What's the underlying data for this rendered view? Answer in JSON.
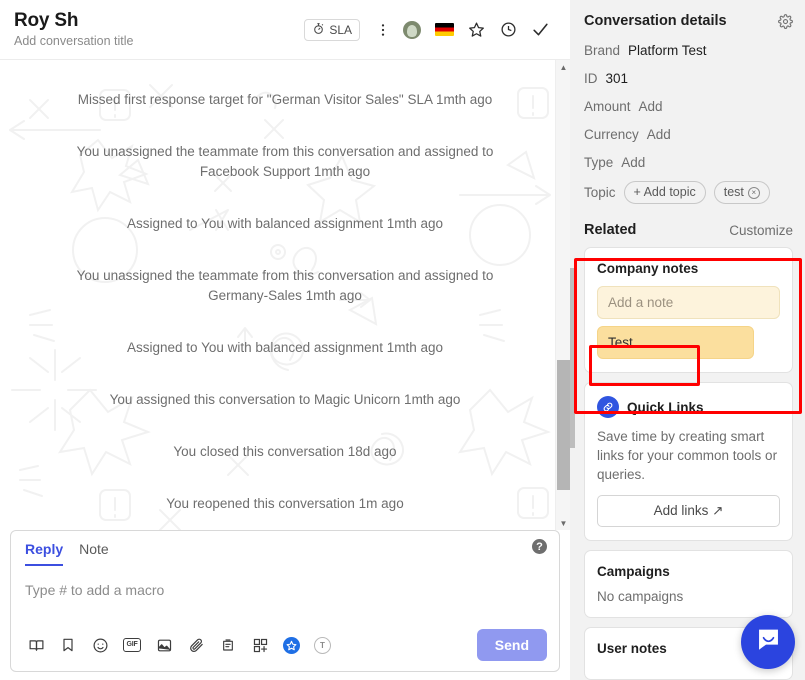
{
  "header": {
    "title": "Roy Sh",
    "subtitle": "Add conversation title",
    "sla_label": "SLA",
    "icons": {
      "sla": "stopwatch-icon",
      "more": "more-vertical-icon",
      "assignee": "assignee-avatar",
      "language": "german-flag-icon",
      "star": "star-icon",
      "snooze": "clock-icon",
      "close": "checkmark-icon"
    }
  },
  "conversation": {
    "events": [
      "Missed first response target for \"German Visitor Sales\" SLA 1mth ago",
      "You unassigned the teammate from this conversation and assigned to Facebook Support 1mth ago",
      "Assigned to You with balanced assignment 1mth ago",
      "You unassigned the teammate from this conversation and assigned to Germany-Sales 1mth ago",
      "Assigned to You with balanced assignment 1mth ago",
      "You assigned this conversation to Magic Unicorn 1mth ago",
      "You closed this conversation 18d ago",
      "You reopened this conversation 1m ago"
    ]
  },
  "composer": {
    "tabs": [
      {
        "label": "Reply",
        "active": true
      },
      {
        "label": "Note",
        "active": false
      }
    ],
    "placeholder": "Type # to add a macro",
    "help_label": "?",
    "send_label": "Send",
    "toolbar_icons": [
      "book-icon",
      "bookmark-icon",
      "emoji-icon",
      "gif-icon",
      "image-icon",
      "paperclip-icon",
      "article-icon",
      "apps-add-icon",
      "star-badge-icon",
      "text-format-icon"
    ],
    "gif_label": "GIF",
    "circle_t_label": "T"
  },
  "sidebar": {
    "details_title": "Conversation details",
    "gear_icon": "gear-icon",
    "details": [
      {
        "label": "Brand",
        "value": "Platform Test",
        "is_add": false
      },
      {
        "label": "ID",
        "value": "301",
        "is_add": false
      },
      {
        "label": "Amount",
        "value": "Add",
        "is_add": true
      },
      {
        "label": "Currency",
        "value": "Add",
        "is_add": true
      },
      {
        "label": "Type",
        "value": "Add",
        "is_add": true
      }
    ],
    "topic": {
      "label": "Topic",
      "add_chip": "+ Add topic",
      "tag": "test",
      "tag_remove": "×"
    },
    "related": {
      "title": "Related",
      "customize_label": "Customize"
    },
    "company_notes": {
      "title": "Company notes",
      "input_placeholder": "Add a note",
      "notes": [
        "Test"
      ]
    },
    "quick_links": {
      "icon": "link-icon",
      "title": "Quick Links",
      "description": "Save time by creating smart links for your common tools or queries.",
      "button_label": "Add links ↗"
    },
    "campaigns": {
      "title": "Campaigns",
      "empty_text": "No campaigns"
    },
    "user_notes": {
      "title": "User notes"
    }
  },
  "intercom": {
    "icon": "messenger-icon"
  },
  "colors": {
    "accent": "#3c4fe0",
    "send_button": "#9099f0",
    "note_input_bg": "#fdf3dc",
    "note_item_bg": "#fbdf9e",
    "annotation": "#ff0000",
    "intercom_blue": "#2b44df"
  }
}
